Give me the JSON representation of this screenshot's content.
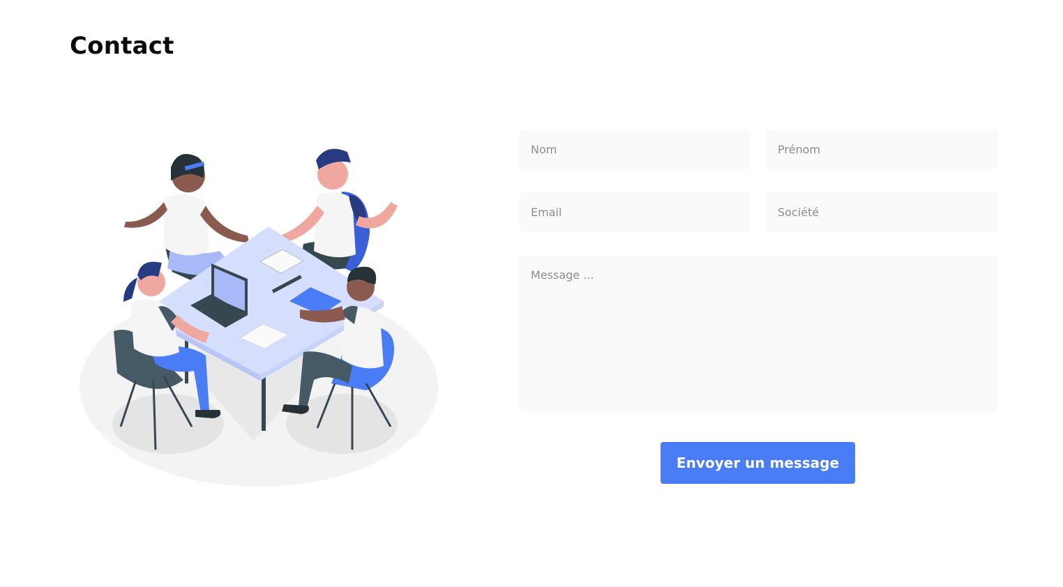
{
  "page": {
    "title": "Contact"
  },
  "form": {
    "nom": {
      "placeholder": "Nom",
      "value": ""
    },
    "prenom": {
      "placeholder": "Prénom",
      "value": ""
    },
    "email": {
      "placeholder": "Email",
      "value": ""
    },
    "societe": {
      "placeholder": "Société",
      "value": ""
    },
    "message": {
      "placeholder": "Message ...",
      "value": ""
    },
    "submit_label": "Envoyer un message"
  },
  "colors": {
    "accent": "#4a7cf6",
    "field_background": "#fafafa",
    "title": "#0b0b0b"
  },
  "illustration": {
    "name": "team-meeting-illustration"
  }
}
